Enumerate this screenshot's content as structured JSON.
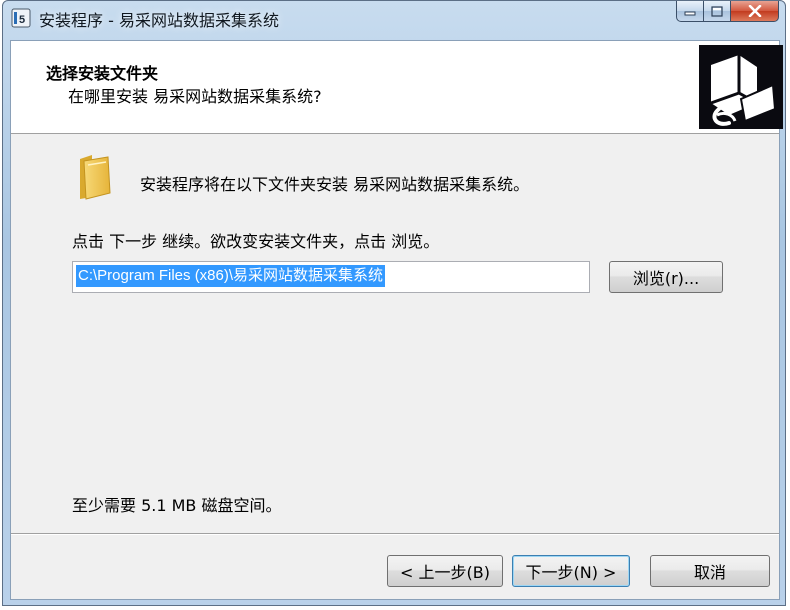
{
  "window": {
    "title": "安装程序 - 易采网站数据采集系统"
  },
  "header": {
    "title": "选择安装文件夹",
    "subtitle": "在哪里安装 易采网站数据采集系统?"
  },
  "main": {
    "intro": "安装程序将在以下文件夹安装 易采网站数据采集系统。",
    "instruction": "点击 下一步 继续。欲改变安装文件夹，点击 浏览。",
    "path_value": "C:\\Program Files (x86)\\易采网站数据采集系统",
    "browse_label": "浏览(r)...",
    "space_required": "至少需要 5.1 MB 磁盘空间。"
  },
  "footer": {
    "back_label": "< 上一步(B)",
    "next_label": "下一步(N) >",
    "cancel_label": "取消"
  },
  "icons": {
    "app": "installer-app-icon",
    "folder": "folder-icon",
    "logo": "setup-computer-icon",
    "minimize": "minimize-icon",
    "maximize": "maximize-icon",
    "close": "close-icon"
  },
  "colors": {
    "selection": "#3399ff",
    "close_button": "#c7452a",
    "titlebar": "#b9d1ea"
  }
}
